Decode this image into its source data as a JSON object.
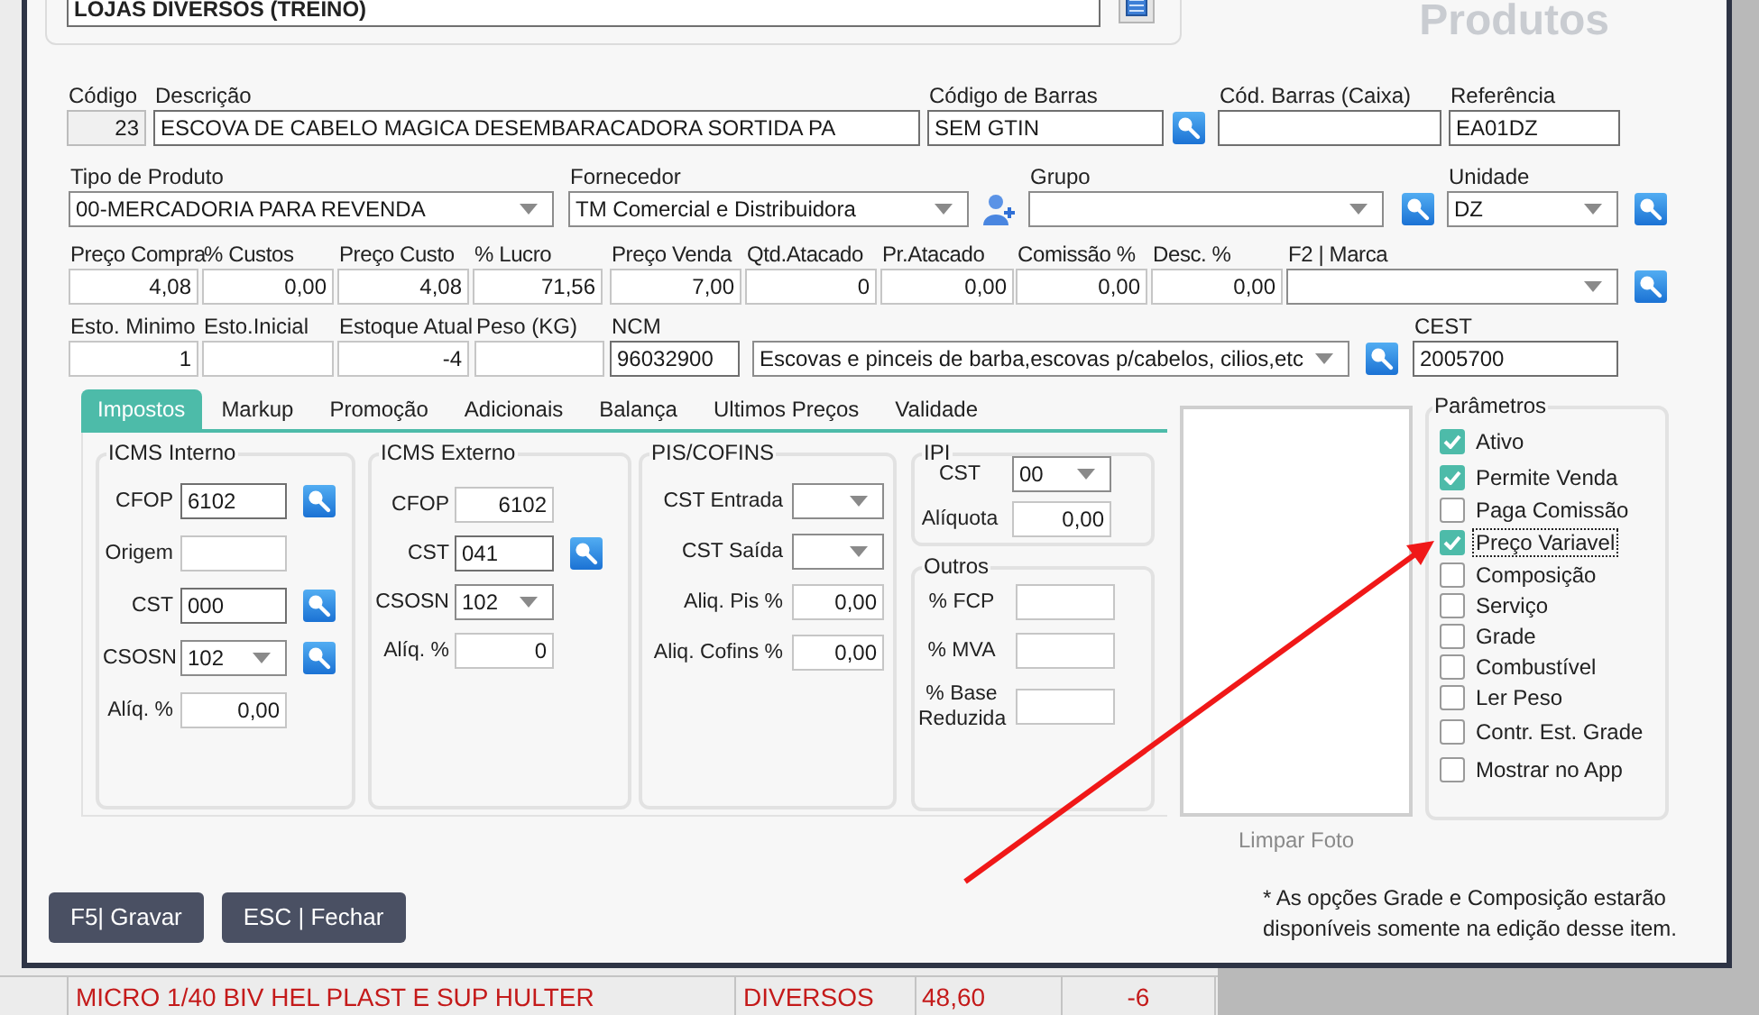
{
  "background_table": {
    "rows": [
      {
        "cells": [
          "MICRO 1/40 BIV HEL PLAST E SUP HULTER",
          "DIVERSOS",
          "48,60",
          "-6"
        ]
      }
    ]
  },
  "dialog": {
    "title": "Produtos",
    "store": "LOJAS DIVERSOS (TREINO)",
    "form_rows": [
      [
        {
          "label": "Código",
          "value": "23",
          "kind": "readonly"
        },
        {
          "label": "Descrição",
          "value": "ESCOVA DE CABELO MAGICA DESEMBARACADORA SORTIDA PA",
          "kind": "text"
        },
        {
          "label": "Código de Barras",
          "value": "SEM GTIN",
          "kind": "text"
        },
        {
          "label": "Cód. Barras (Caixa)",
          "kind": "text"
        },
        {
          "label": "Referência",
          "value": "EA01DZ",
          "kind": "text"
        }
      ],
      [
        {
          "label": "Tipo de Produto",
          "value": "00-MERCADORIA PARA REVENDA",
          "kind": "select"
        },
        {
          "label": "Fornecedor",
          "value": "TM Comercial e Distribuidora",
          "kind": "select"
        },
        {
          "label": "Grupo",
          "kind": "select"
        },
        {
          "label": "Unidade",
          "value": "DZ",
          "kind": "select"
        }
      ],
      [
        {
          "label": "Preço Compra",
          "value": "4,08",
          "kind": "number"
        },
        {
          "label": "% Custos",
          "value": "0,00",
          "kind": "number"
        },
        {
          "label": "Preço Custo",
          "value": "4,08",
          "kind": "number"
        },
        {
          "label": "% Lucro",
          "value": "71,56",
          "kind": "number"
        },
        {
          "label": "Preço Venda",
          "value": "7,00",
          "kind": "number"
        },
        {
          "label": "Qtd.Atacado",
          "value": "0",
          "kind": "number"
        },
        {
          "label": "Pr.Atacado",
          "value": "0,00",
          "kind": "number"
        },
        {
          "label": "Comissão %",
          "value": "0,00",
          "kind": "number"
        },
        {
          "label": "Desc. %",
          "value": "0,00",
          "kind": "number"
        },
        {
          "label": "F2 | Marca",
          "kind": "select"
        }
      ],
      [
        {
          "label": "Esto. Minimo",
          "value": "1",
          "kind": "number"
        },
        {
          "label": "Esto.Inicial",
          "kind": "number"
        },
        {
          "label": "Estoque Atual",
          "value": "-4",
          "kind": "number"
        },
        {
          "label": "Peso (KG)",
          "kind": "number"
        },
        {
          "label": "NCM",
          "value": "96032900",
          "kind": "text"
        },
        {
          "value": "Escovas e pinceis de barba,escovas p/cabelos, cilios,etc",
          "kind": "select"
        },
        {
          "label": "CEST",
          "value": "2005700",
          "kind": "text"
        }
      ]
    ],
    "tabs": [
      {
        "label": "Impostos",
        "selected": true
      },
      {
        "label": "Markup",
        "selected": false
      },
      {
        "label": "Promoção",
        "selected": false
      },
      {
        "label": "Adicionais",
        "selected": false
      },
      {
        "label": "Balança",
        "selected": false
      },
      {
        "label": "Ultimos Preços",
        "selected": false
      },
      {
        "label": "Validade",
        "selected": false
      }
    ],
    "tax_groups": [
      {
        "title": "ICMS Interno",
        "rows": [
          {
            "label": "CFOP",
            "value": "6102",
            "kind": "text"
          },
          {
            "label": "Origem",
            "kind": "number"
          },
          {
            "label": "CST",
            "value": "000",
            "kind": "text"
          },
          {
            "label": "CSOSN",
            "value": "102",
            "kind": "select"
          },
          {
            "label": "Alíq. %",
            "value": "0,00",
            "kind": "number"
          }
        ]
      },
      {
        "title": "ICMS Externo",
        "rows": [
          {
            "label": "CFOP",
            "value": "6102",
            "kind": "number"
          },
          {
            "label": "CST",
            "value": "041",
            "kind": "text"
          },
          {
            "label": "CSOSN",
            "value": "102",
            "kind": "select"
          },
          {
            "label": "Alíq. %",
            "value": "0",
            "kind": "number"
          }
        ]
      },
      {
        "title": "PIS/COFINS",
        "rows": [
          {
            "label": "CST Entrada",
            "kind": "select"
          },
          {
            "label": "CST Saída",
            "kind": "select"
          },
          {
            "label": "Aliq. Pis %",
            "value": "0,00",
            "kind": "number"
          },
          {
            "label": "Aliq. Cofins %",
            "value": "0,00",
            "kind": "number"
          }
        ]
      },
      {
        "title": "IPI",
        "rows": [
          {
            "label": "CST",
            "value": "00",
            "kind": "select"
          },
          {
            "label": "Alíquota",
            "value": "0,00",
            "kind": "number"
          }
        ]
      },
      {
        "title": "Outros",
        "rows": [
          {
            "label": "% FCP",
            "kind": "number"
          },
          {
            "label": "% MVA",
            "kind": "number"
          },
          {
            "label": "% Base Reduzida",
            "kind": "number"
          }
        ]
      }
    ],
    "photo": {
      "button": "Limpar Foto"
    },
    "parameters": {
      "title": "Parâmetros",
      "items": [
        {
          "label": "Ativo",
          "checked": true,
          "focused": false
        },
        {
          "label": "Permite Venda",
          "checked": true,
          "focused": false
        },
        {
          "label": "Paga Comissão",
          "checked": false,
          "focused": false
        },
        {
          "label": "Preço Variavel",
          "checked": true,
          "focused": true
        },
        {
          "label": "Composição",
          "checked": false,
          "focused": false
        },
        {
          "label": "Serviço",
          "checked": false,
          "focused": false
        },
        {
          "label": "Grade",
          "checked": false,
          "focused": false
        },
        {
          "label": "Combustível",
          "checked": false,
          "focused": false
        },
        {
          "label": "Ler Peso",
          "checked": false,
          "focused": false
        },
        {
          "label": "Contr. Est. Grade",
          "checked": false,
          "focused": false
        },
        {
          "label": "Mostrar no App",
          "checked": false,
          "focused": false
        }
      ]
    },
    "buttons": [
      "F5| Gravar",
      "ESC | Fechar"
    ],
    "note": "* As opções Grade e Composição estarão disponíveis somente na edição desse item."
  }
}
